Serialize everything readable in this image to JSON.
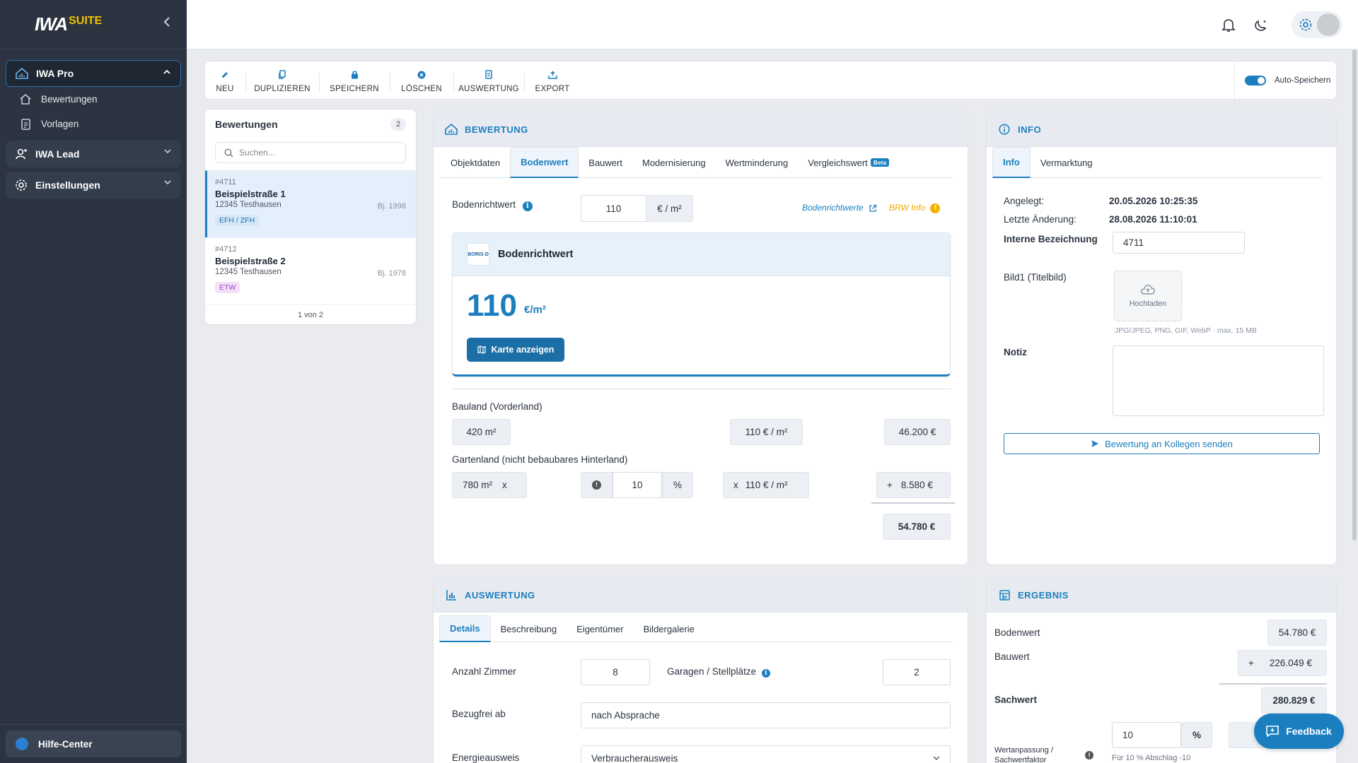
{
  "brand": {
    "name": "IWA",
    "suite": "SUITE"
  },
  "sidebar": {
    "groups": [
      {
        "label": "IWA Pro",
        "icon": "house-chart-icon",
        "items": [
          {
            "label": "Bewertungen",
            "icon": "home-icon"
          },
          {
            "label": "Vorlagen",
            "icon": "document-icon"
          }
        ]
      },
      {
        "label": "IWA Lead",
        "icon": "user-lead-icon"
      },
      {
        "label": "Einstellungen",
        "icon": "gear-icon"
      }
    ],
    "help": "Hilfe-Center"
  },
  "toolbar": {
    "items": [
      {
        "label": "NEU",
        "icon": "pencil-icon"
      },
      {
        "label": "DUPLIZIEREN",
        "icon": "copy-icon"
      },
      {
        "label": "SPEICHERN",
        "icon": "lock-icon"
      },
      {
        "label": "LÖSCHEN",
        "icon": "delete-icon"
      },
      {
        "label": "AUSWERTUNG",
        "icon": "report-icon"
      },
      {
        "label": "EXPORT",
        "icon": "export-icon"
      }
    ],
    "autosave": "Auto-Speichern"
  },
  "list": {
    "title": "Bewertungen",
    "count": "2",
    "search_placeholder": "Suchen...",
    "items": [
      {
        "id": "#4711",
        "street": "Beispielstraße 1",
        "city": "12345 Testhausen",
        "year": "Bj. 1998",
        "tag": "EFH / ZFH"
      },
      {
        "id": "#4712",
        "street": "Beispielstraße 2",
        "city": "12345 Testhausen",
        "year": "Bj. 1978",
        "tag": "ETW"
      }
    ],
    "pagination": "1 von 2"
  },
  "bewertung": {
    "title": "BEWERTUNG",
    "tabs": [
      "Objektdaten",
      "Bodenwert",
      "Bauwert",
      "Modernisierung",
      "Wertminderung",
      "Vergleichswert"
    ],
    "beta": "Beta",
    "brw_label": "Bodenrichtwert",
    "brw_value": "110",
    "brw_unit": "€ / m²",
    "link_brw": "Bodenrichtwerte",
    "link_info": "BRW Info",
    "boris": {
      "logo": "BORIS-D",
      "title": "Bodenrichtwert",
      "value": "110",
      "unit": "€/m²",
      "button": "Karte anzeigen"
    },
    "bauland_label": "Bauland (Vorderland)",
    "bauland_area": "420  m²",
    "bauland_price": "110  € / m²",
    "bauland_total": "46.200  €",
    "garten_label": "Gartenland (nicht bebaubares Hinterland)",
    "garten_area": "780  m²",
    "garten_x": "x",
    "garten_percent": "10",
    "garten_percent_unit": "%",
    "garten_price": "110  € / m²",
    "garten_price_x": "x",
    "garten_total": "8.580  €",
    "garten_plus": "+",
    "sum": "54.780 €"
  },
  "info": {
    "title": "INFO",
    "tabs": [
      "Info",
      "Vermarktung"
    ],
    "created_label": "Angelegt:",
    "created": "20.05.2026 10:25:35",
    "changed_label": "Letzte Änderung:",
    "changed": "28.08.2026 11:10:01",
    "internal_label": "Interne Bezeichnung",
    "internal": "4711",
    "image_label": "Bild1 (Titelbild)",
    "upload": "Hochladen",
    "upload_hint": "JPG/JPEG, PNG, GIF, WebP · max. 15 MB",
    "note_label": "Notiz",
    "send_button": "Bewertung an Kollegen senden"
  },
  "auswertung": {
    "title": "AUSWERTUNG",
    "tabs": [
      "Details",
      "Beschreibung",
      "Eigentümer",
      "Bildergalerie"
    ],
    "rooms_label": "Anzahl Zimmer",
    "rooms": "8",
    "garages_label": "Garagen / Stellplätze",
    "garages": "2",
    "free_label": "Bezugfrei ab",
    "free": "nach Absprache",
    "energy_label": "Energieausweis",
    "energy": "Verbraucherausweis"
  },
  "ergebnis": {
    "title": "ERGEBNIS",
    "bodenwert_label": "Bodenwert",
    "bodenwert": "54.780 €",
    "bauwert_label": "Bauwert",
    "bauwert": "226.049 €",
    "bauwert_plus": "+",
    "sachwert_label": "Sachwert",
    "sachwert": "280.829 €",
    "percent": "10",
    "percent_unit": "%",
    "anpassung_label": "Wertanpassung / Sachwertfaktor",
    "anpassung_hint": "Für 10 % Abschlag -10"
  },
  "feedback": "Feedback",
  "colors": {
    "accent": "#1b7fbf",
    "sidebar": "#2c3441",
    "brand_yellow": "#f2c200",
    "tag_blue_bg": "#d6e8f8",
    "tag_purple_bg": "#f1e2f8"
  }
}
